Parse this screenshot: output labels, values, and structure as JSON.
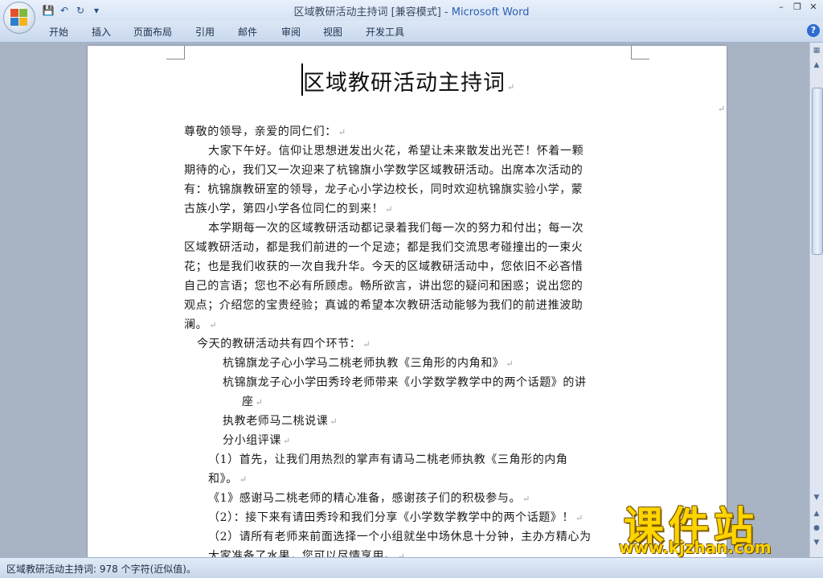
{
  "window": {
    "title_doc": "区域教研活动主持词 [兼容模式] - ",
    "title_app": "Microsoft Word"
  },
  "qat": [
    "save-icon",
    "undo-icon",
    "redo-icon",
    "customize-icon"
  ],
  "tabs": [
    "开始",
    "插入",
    "页面布局",
    "引用",
    "邮件",
    "审阅",
    "视图",
    "开发工具"
  ],
  "document": {
    "title": "区域教研活动主持词",
    "lines": [
      "尊敬的领导，亲爱的同仁们：",
      "大家下午好。信仰让思想迸发出火花，希望让未来散发出光芒！怀着一颗",
      "期待的心，我们又一次迎来了杭锦旗小学数学区域教研活动。出席本次活动的",
      "有：杭锦旗教研室的领导，龙子心小学边校长，同时欢迎杭锦旗实验小学，蒙",
      "古族小学，第四小学各位同仁的到来！",
      "本学期每一次的区域教研活动都记录着我们每一次的努力和付出；每一次",
      "区域教研活动，都是我们前进的一个足迹；都是我们交流思考碰撞出的一束火",
      "花；也是我们收获的一次自我升华。今天的区域教研活动中，您依旧不必吝惜",
      "自己的言语；您也不必有所顾虑。畅所欲言，讲出您的疑问和困惑；说出您的",
      "观点；介绍您的宝贵经验；真诚的希望本次教研活动能够为我们的前进推波助",
      "澜。",
      "今天的教研活动共有四个环节：",
      "杭锦旗龙子心小学马二桃老师执教《三角形的内角和》",
      "杭锦旗龙子心小学田秀玲老师带来《小学数学教学中的两个话题》的讲",
      "座",
      "执教老师马二桃说课",
      "分小组评课",
      "（1）首先，让我们用热烈的掌声有请马二桃老师执教《三角形的内角",
      "和》。",
      "《1》感谢马二桃老师的精心准备，感谢孩子们的积极参与。",
      "（2）：接下来有请田秀玲和我们分享《小学数学教学中的两个话题》！",
      "（2）请所有老师来前面选择一个小组就坐中场休息十分钟，主办方精心为",
      "大家准备了水果，您可以尽情享用。"
    ]
  },
  "status": {
    "text": "区域教研活动主持词: 978 个字符(近似值)。"
  },
  "watermark": {
    "main": "课件站",
    "url": "www.kjzhan.com"
  },
  "colors": {
    "ribbon": "#d6e3f4",
    "app_title": "#2b5fb0",
    "watermark": "#ffd400"
  }
}
